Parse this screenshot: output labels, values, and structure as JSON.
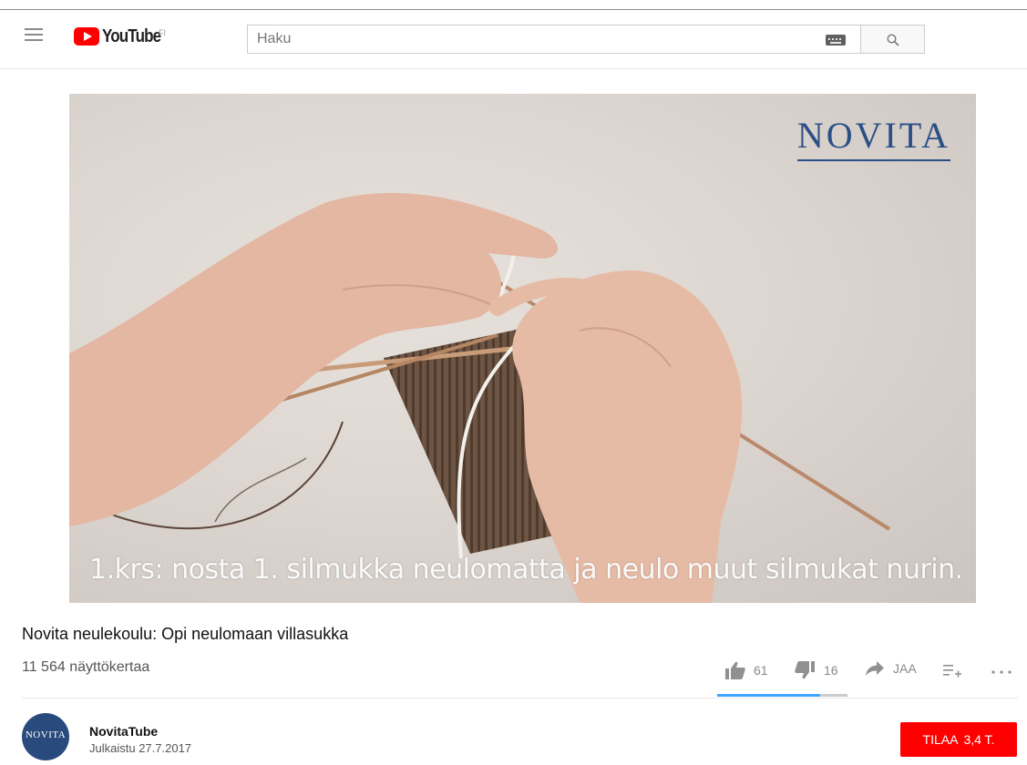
{
  "masthead": {
    "logo_text": "YouTube",
    "country_code": "FI",
    "search_placeholder": "Haku"
  },
  "video": {
    "brand_overlay": "NOVITA",
    "caption": "1.krs: nosta 1. silmukka neulomatta ja neulo muut silmukat nurin."
  },
  "info": {
    "title": "Novita neulekoulu: Opi neulomaan villasukka",
    "views": "11 564 näyttökertaa",
    "likes": "61",
    "dislikes": "16",
    "share_label": "JAA",
    "like_ratio": 0.79
  },
  "channel": {
    "avatar_text": "NOVITA",
    "name": "NovitaTube",
    "published": "Julkaistu 27.7.2017",
    "subscribe_label": "TILAA",
    "subscriber_count": "3,4 T."
  },
  "icons": [
    "menu-icon",
    "youtube-logo-icon",
    "keyboard-icon",
    "search-icon",
    "thumb-up-icon",
    "thumb-down-icon",
    "share-icon",
    "add-to-playlist-icon",
    "more-icon"
  ],
  "colors": {
    "brand_red": "#ff0000",
    "novita_blue": "#2b4f86",
    "sentiment_blue": "#3ea6ff"
  }
}
